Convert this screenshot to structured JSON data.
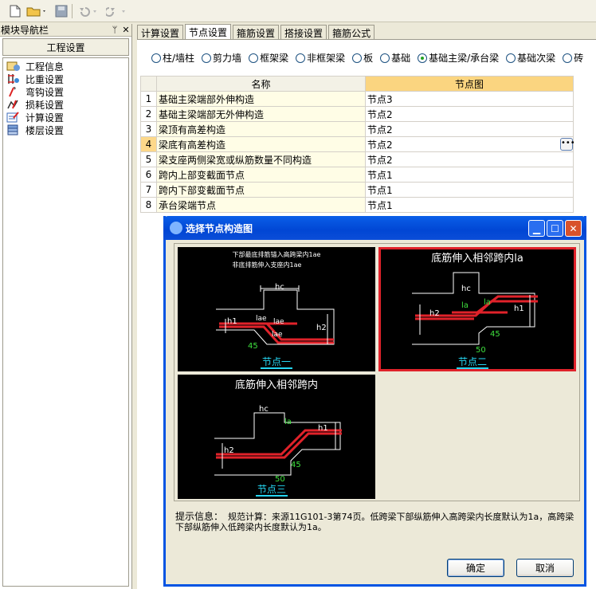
{
  "nav": {
    "header": "模块导航栏",
    "pin": "ᛘ",
    "close": "✕",
    "title": "工程设置",
    "items": [
      {
        "label": "工程信息",
        "icon": "project-info-icon"
      },
      {
        "label": "比重设置",
        "icon": "density-icon"
      },
      {
        "label": "弯钩设置",
        "icon": "hook-icon"
      },
      {
        "label": "损耗设置",
        "icon": "loss-icon"
      },
      {
        "label": "计算设置",
        "icon": "calc-settings-icon"
      },
      {
        "label": "楼层设置",
        "icon": "floor-icon"
      }
    ]
  },
  "tabs": [
    "计算设置",
    "节点设置",
    "箍筋设置",
    "搭接设置",
    "箍筋公式"
  ],
  "active_tab": "节点设置",
  "radios": [
    {
      "label": "柱/墙柱",
      "selected": false
    },
    {
      "label": "剪力墙",
      "selected": false
    },
    {
      "label": "框架梁",
      "selected": false
    },
    {
      "label": "非框架梁",
      "selected": false
    },
    {
      "label": "板",
      "selected": false
    },
    {
      "label": "基础",
      "selected": false
    },
    {
      "label": "基础主梁/承台梁",
      "selected": true
    },
    {
      "label": "基础次梁",
      "selected": false
    },
    {
      "label": "砖",
      "selected": false
    }
  ],
  "table": {
    "headers": {
      "name": "名称",
      "node": "节点图"
    },
    "rows": [
      {
        "idx": "1",
        "name": "基础主梁端部外伸构造",
        "node": "节点3"
      },
      {
        "idx": "2",
        "name": "基础主梁端部无外伸构造",
        "node": "节点2"
      },
      {
        "idx": "3",
        "name": "梁顶有高差构造",
        "node": "节点2"
      },
      {
        "idx": "4",
        "name": "梁底有高差构造",
        "node": "节点2"
      },
      {
        "idx": "5",
        "name": "梁支座两侧梁宽或纵筋数量不同构造",
        "node": "节点2"
      },
      {
        "idx": "6",
        "name": "跨内上部变截面节点",
        "node": "节点1"
      },
      {
        "idx": "7",
        "name": "跨内下部变截面节点",
        "node": "节点1"
      },
      {
        "idx": "8",
        "name": "承台梁端节点",
        "node": "节点1"
      }
    ],
    "highlighted_row": 3
  },
  "dialog": {
    "title": "选择节点构造图",
    "thumbs": [
      {
        "caption": "节点一",
        "note1": "下部最底排筋锚入高跨梁内1ae",
        "note2": "非底排筋伸入支座内1ae",
        "labels": {
          "hc": "hc",
          "h1": "h1",
          "h2": "h2",
          "lae1": "lae",
          "lae2": "lae",
          "lae3": "lae",
          "deg": "45"
        }
      },
      {
        "caption": "节点二",
        "heading": "底筋伸入相邻跨内la",
        "labels": {
          "hc": "hc",
          "h1": "h1",
          "h2": "h2",
          "la1": "la",
          "la2": "la",
          "deg": "45",
          "len": "50"
        }
      },
      {
        "caption": "节点三",
        "heading": "底筋伸入相邻跨内",
        "labels": {
          "hc": "hc",
          "h1": "h1",
          "h2": "h2",
          "la": "la",
          "deg": "45",
          "len": "50"
        }
      }
    ],
    "hint_label": "提示信息：",
    "hint_text": "规范计算：来源11G101-3第74页。低跨梁下部纵筋伸入高跨梁内长度默认为1a，高跨梁下部纵筋伸入低跨梁内长度默认为1a。",
    "ok": "确定",
    "cancel": "取消"
  },
  "colors": {
    "rebar": "#e0222a",
    "dim": "#ffffff",
    "green": "#3ee03e",
    "caption": "#25d6f2"
  }
}
